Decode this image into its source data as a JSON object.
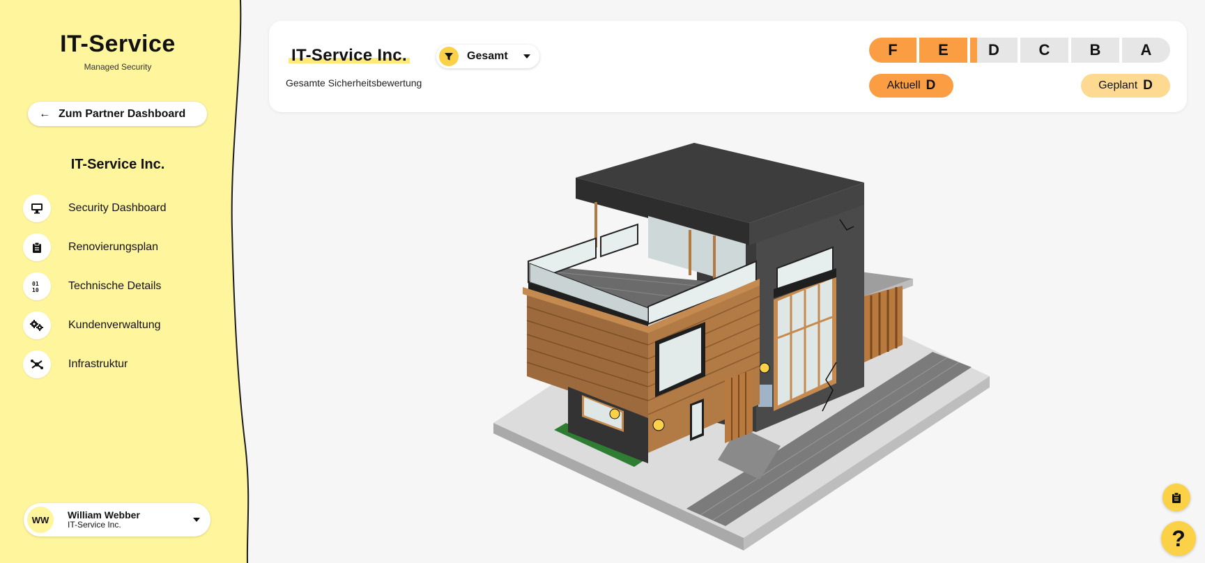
{
  "sidebar": {
    "brand_title": "IT-Service",
    "brand_subtitle": "Managed Security",
    "back_label": "Zum Partner Dashboard",
    "company_name": "IT-Service Inc.",
    "items": [
      {
        "label": "Security Dashboard",
        "icon": "monitor-icon"
      },
      {
        "label": "Renovierungsplan",
        "icon": "clipboard-icon"
      },
      {
        "label": "Technische Details",
        "icon": "binary-icon"
      },
      {
        "label": "Kundenverwaltung",
        "icon": "gears-icon"
      },
      {
        "label": "Infrastruktur",
        "icon": "network-icon"
      }
    ],
    "user": {
      "initials": "WW",
      "name": "William Webber",
      "org": "IT-Service Inc."
    }
  },
  "header": {
    "title": "IT-Service Inc.",
    "subtitle": "Gesamte Sicherheitsbewertung",
    "filter": {
      "value": "Gesamt",
      "icon": "filter-icon"
    },
    "grades": [
      "F",
      "E",
      "D",
      "C",
      "B",
      "A"
    ],
    "current": {
      "label": "Aktuell",
      "grade": "D"
    },
    "planned": {
      "label": "Geplant",
      "grade": "D"
    }
  },
  "floating": {
    "clipboard_icon": "clipboard-icon",
    "help_label": "?"
  },
  "colors": {
    "sidebar_bg": "#fff59d",
    "accent_yellow": "#fbd148",
    "grade_active": "#fb9e43",
    "grade_inactive": "#e6e6e6",
    "planned_bg": "#fdd992",
    "page_bg": "#f6f6f6"
  }
}
